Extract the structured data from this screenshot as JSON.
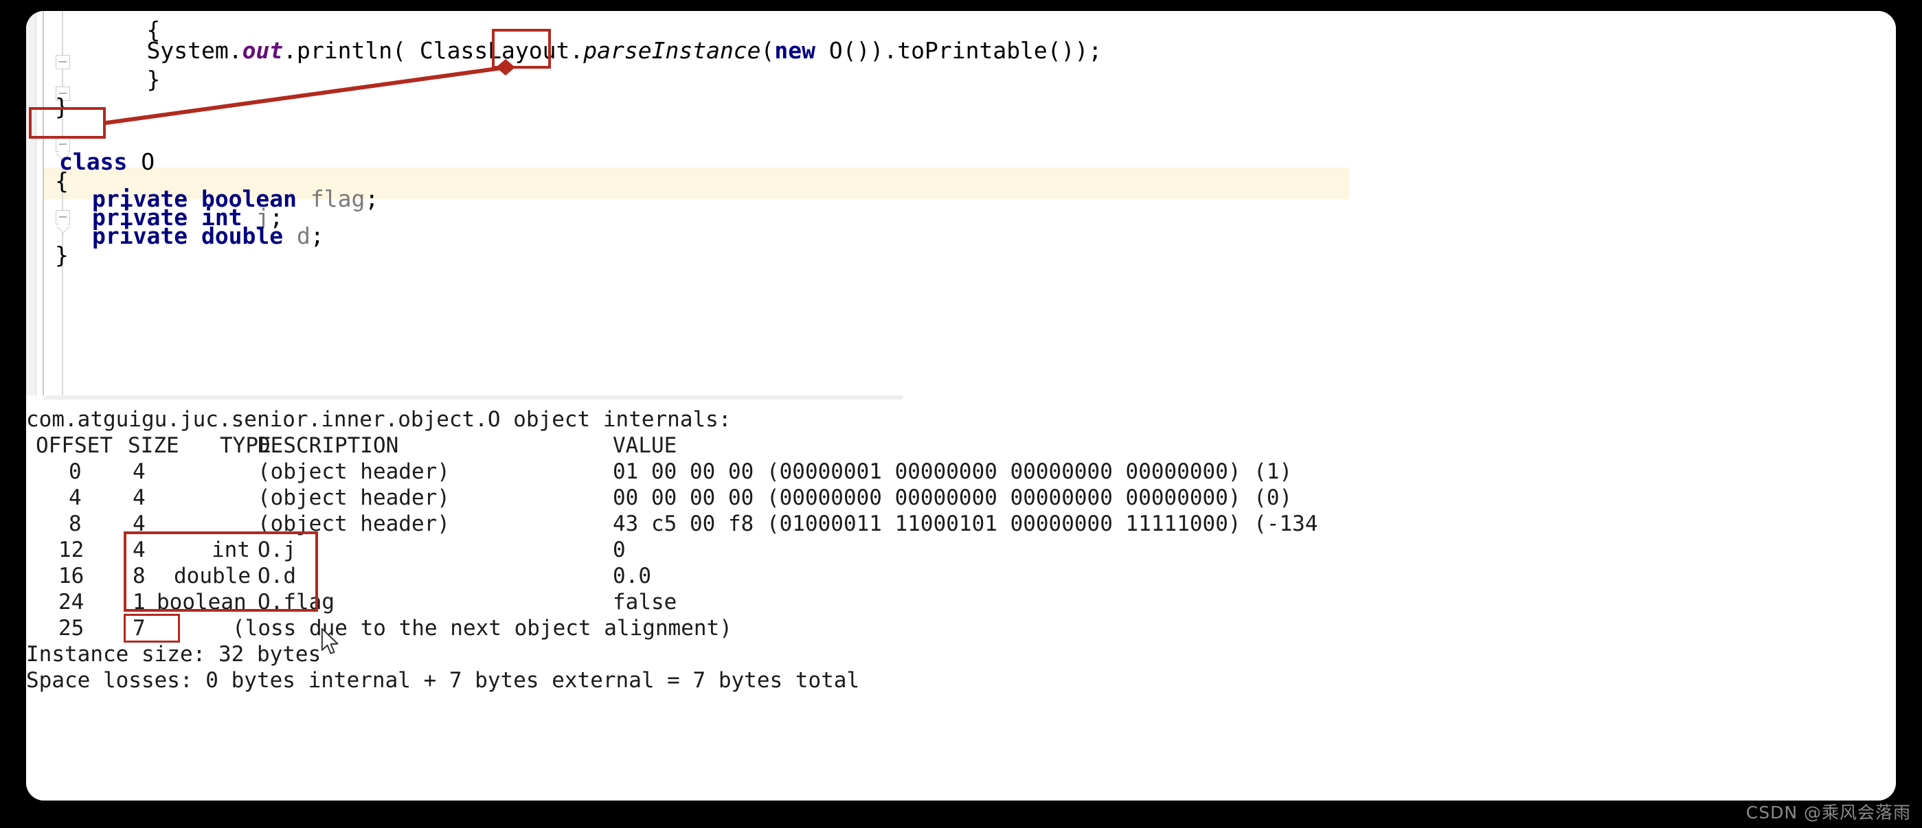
{
  "editor": {
    "code_lines": [
      {
        "id": "line-open-brace-1",
        "text": "    {"
      },
      {
        "id": "line-println",
        "text": "        System.out.println( ClassLayout.parseInstance(new O()).toPrintable());"
      },
      {
        "id": "line-close-brace-1",
        "text": "    }"
      },
      {
        "id": "line-close-brace-2",
        "text": "}"
      },
      {
        "id": "line-class-decl",
        "text": "class O"
      },
      {
        "id": "line-open-brace-2",
        "text": "{"
      },
      {
        "id": "line-field-flag",
        "text": "    private boolean flag;"
      },
      {
        "id": "line-field-j",
        "text": "    private int j;"
      },
      {
        "id": "line-field-d",
        "text": "    private double d;"
      },
      {
        "id": "line-close-brace-3",
        "text": "}"
      }
    ],
    "tokens": {
      "system": "System.",
      "out": "out",
      "println": ".println( ClassLayout.",
      "parse_instance": "parseInstance",
      "paren_open": "(",
      "new_kw": "new",
      "new_obj": " O()",
      "tail": ").toPrintable());",
      "class_kw": "class",
      "class_name": " O",
      "private_kw": "private",
      "boolean_kw": " boolean",
      "flag_name": " flag",
      "int_kw": " int",
      "j_name": " j",
      "double_kw": " double",
      "d_name": " d",
      "semicolon": ";",
      "brace_open": "{",
      "brace_close": "}"
    },
    "annotations": {
      "box_new_o_label": "new O()",
      "box_class_o_label": "class O",
      "arrow_label": "arrow-class-to-new"
    }
  },
  "console": {
    "header_line": "com.atguigu.juc.senior.inner.object.O object internals:",
    "columns": {
      "offset": "OFFSET",
      "size": "SIZE",
      "type": "TYPE",
      "description": "DESCRIPTION",
      "value": "VALUE"
    },
    "rows": [
      {
        "offset": "0",
        "size": "4",
        "type": "",
        "description": "(object header)",
        "value": "01 00 00 00 (00000001 00000000 00000000 00000000) (1)"
      },
      {
        "offset": "4",
        "size": "4",
        "type": "",
        "description": "(object header)",
        "value": "00 00 00 00 (00000000 00000000 00000000 00000000) (0)"
      },
      {
        "offset": "8",
        "size": "4",
        "type": "",
        "description": "(object header)",
        "value": "43 c5 00 f8 (01000011 11000101 00000000 11111000) (-134"
      },
      {
        "offset": "12",
        "size": "4",
        "type": "int",
        "description": "O.j",
        "value": "0"
      },
      {
        "offset": "16",
        "size": "8",
        "type": "double",
        "description": "O.d",
        "value": "0.0"
      },
      {
        "offset": "24",
        "size": "1",
        "type": "boolean",
        "description": "O.flag",
        "value": "false"
      },
      {
        "offset": "25",
        "size": "7",
        "type": "",
        "description": "(loss due to the next object alignment)",
        "value": ""
      }
    ],
    "summary": {
      "instance_size": "Instance size: 32 bytes",
      "space_losses": "Space losses: 0 bytes internal + 7 bytes external = 7 bytes total"
    },
    "annotations": {
      "box_fields_label": "fields-block-highlight",
      "box_padding_label": "padding-size-highlight"
    }
  },
  "watermark": {
    "text": "CSDN @乘风会落雨"
  },
  "colors": {
    "annotation_red": "#b22a1e",
    "keyword_blue": "#000080",
    "static_purple": "#660e7a",
    "field_gray": "#7a7a7a",
    "line_highlight": "#fdf6e0",
    "panel_bg": "#ffffff",
    "page_bg": "#000000"
  }
}
